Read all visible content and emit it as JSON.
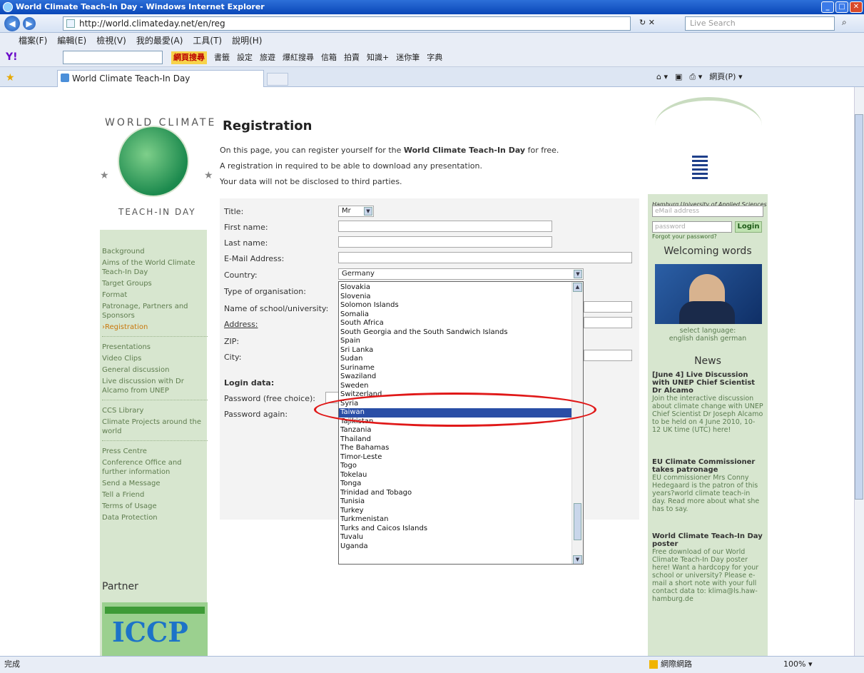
{
  "window": {
    "title": "World Climate Teach-In Day - Windows Internet Explorer"
  },
  "address": {
    "url": "http://world.climateday.net/en/reg",
    "search_placeholder": "Live Search"
  },
  "menu": [
    "檔案(F)",
    "編輯(E)",
    "檢視(V)",
    "我的最愛(A)",
    "工具(T)",
    "說明(H)"
  ],
  "yahoo": {
    "logo": "Y!",
    "buttons": [
      "網頁搜尋",
      "書籤",
      "設定",
      "旅遊",
      "爆紅搜尋",
      "信箱",
      "拍賣",
      "知識+",
      "迷你筆",
      "字典"
    ]
  },
  "tab": {
    "label": "World Climate Teach-In Day"
  },
  "tools": [
    "網頁(P) ▾"
  ],
  "logo": {
    "top": "WORLD CLIMATE",
    "bottom": "TEACH-IN DAY"
  },
  "sidebar": {
    "groups": [
      [
        "Background",
        "Aims of the World Climate Teach-In Day",
        "Target Groups",
        "Format",
        "Patronage, Partners and Sponsors",
        "›Registration"
      ],
      [
        "Presentations",
        "Video Clips",
        "General discussion",
        "Live discussion with Dr Alcamo from UNEP"
      ],
      [
        "CCS Library",
        "Climate Projects around the world"
      ],
      [
        "Press Centre",
        "Conference Office and further information",
        "Send a Message",
        "Tell a Friend",
        "Terms of Usage",
        "Data Protection"
      ]
    ],
    "partner_label": "Partner",
    "partner_logo": "ICCP"
  },
  "main": {
    "heading": "Registration",
    "intro1_pre": "On this page, you can register yourself for the ",
    "intro1_bold": "World Climate Teach-In Day",
    "intro1_post": " for free.",
    "intro2": "A registration in required to be able to download any presentation.",
    "intro3": "Your data will not be disclosed to third parties."
  },
  "form": {
    "title_label": "Title:",
    "title_value": "Mr",
    "first_name_label": "First name:",
    "last_name_label": "Last name:",
    "email_label": "E-Mail Address:",
    "country_label": "Country:",
    "country_value": "Germany",
    "org_label": "Type of organisation:",
    "school_label": "Name of school/university:",
    "address_label": "Address:",
    "zip_label": "ZIP:",
    "city_label": "City:",
    "login_label": "Login data:",
    "password_label": "Password (free choice):",
    "password_again_label": "Password again:"
  },
  "country_options": [
    "Slovakia",
    "Slovenia",
    "Solomon Islands",
    "Somalia",
    "South Africa",
    "South Georgia and the South Sandwich Islands",
    "Spain",
    "Sri Lanka",
    "Sudan",
    "Suriname",
    "Swaziland",
    "Sweden",
    "Switzerland",
    "Syria",
    "Taiwan",
    "Tajikistan",
    "Tanzania",
    "Thailand",
    "The Bahamas",
    "Timor-Leste",
    "Togo",
    "Tokelau",
    "Tonga",
    "Trinidad and Tobago",
    "Tunisia",
    "Turkey",
    "Turkmenistan",
    "Turks and Caicos Islands",
    "Tuvalu",
    "Uganda"
  ],
  "selected_country": "Taiwan",
  "highlight_color": "#e01818",
  "right": {
    "haw": "Hamburg University of Applied Sciences",
    "email_placeholder": "eMail address",
    "password_placeholder": "password",
    "login": "Login",
    "forgot": "Forgot your password?",
    "welcoming": "Welcoming words",
    "select_language": "select language:",
    "languages": "english  danish  german",
    "news_title": "News",
    "news": [
      {
        "title": "[June 4] Live Discussion with UNEP   Chief Scientist Dr Alcamo",
        "body": "Join the interactive discussion about climate change with UNEP   Chief Scientist Dr Joseph Alcamo to be held on 4 June 2010, 10-12 UK time (UTC) here!"
      },
      {
        "title": "EU Climate Commissioner takes patronage",
        "body": "EU commissioner Mrs Conny Hedegaard is the patron of this years?world climate teach-in day. Read more about what she has to say."
      },
      {
        "title": "World Climate Teach-In Day poster",
        "body": "Free download of our World Climate Teach-In Day poster here! Want a hardcopy for your school or university? Please e-mail a short note with your full contact data to: klima@ls.haw-hamburg.de"
      }
    ]
  },
  "status": {
    "left": "完成",
    "zone": "網際網路",
    "zoom": "100%"
  }
}
